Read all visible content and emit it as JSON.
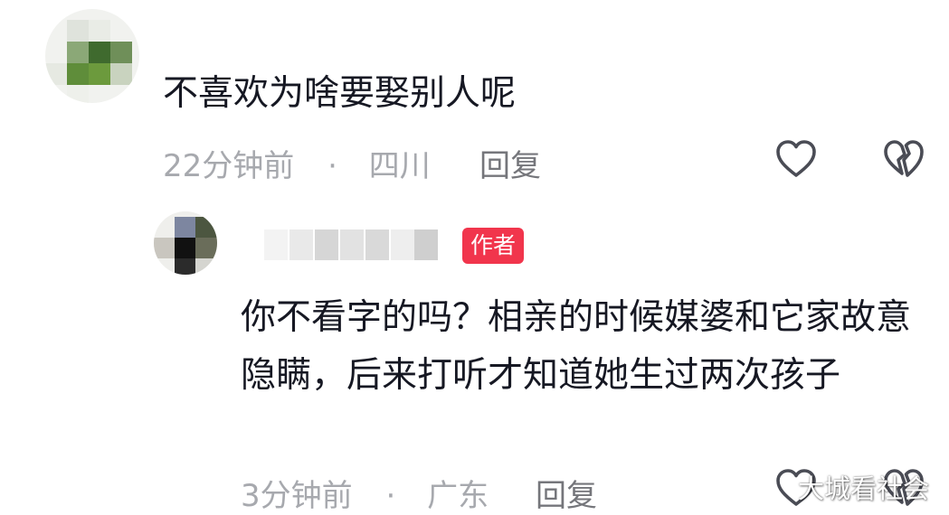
{
  "comment": {
    "text": "不喜欢为啥要娶别人呢",
    "time": "22分钟前",
    "separator": "·",
    "location": "四川",
    "reply_label": "回复",
    "like_icon": "heart-outline-icon",
    "dislike_icon": "broken-heart-icon"
  },
  "reply": {
    "author_badge": "作者",
    "text": "你不看字的吗？相亲的时候媒婆和它家故意隐瞒，后来打听才知道她生过两次孩子",
    "time": "3分钟前",
    "separator": "·",
    "location": "广东",
    "reply_label": "回复",
    "like_icon": "heart-outline-icon",
    "dislike_icon": "broken-heart-icon"
  },
  "watermark": "大城看社会",
  "colors": {
    "text": "#161823",
    "meta": "#a7a9ae",
    "badge": "#f1354c"
  }
}
